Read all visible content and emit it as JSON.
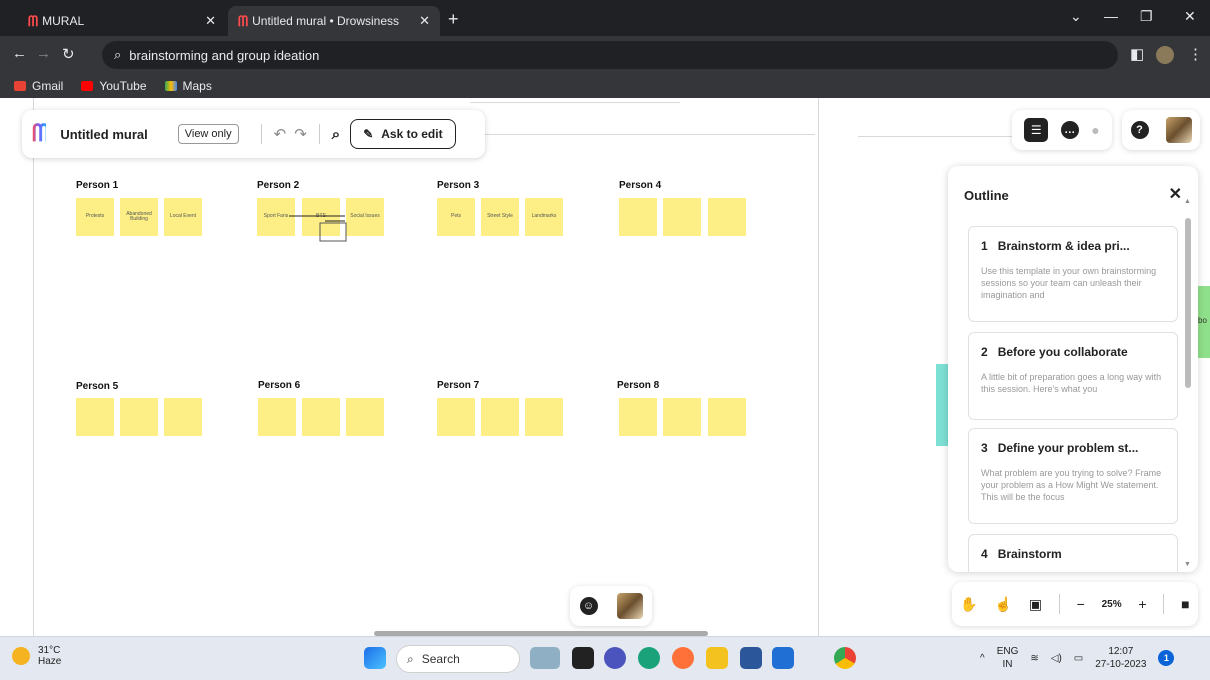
{
  "browser": {
    "tabs": [
      {
        "label": "MURAL"
      },
      {
        "label": "Untitled mural • Drowsiness dete"
      }
    ],
    "address": "brainstorming and group ideation",
    "bookmarks": [
      "Gmail",
      "YouTube",
      "Maps"
    ]
  },
  "toolbar": {
    "title": "Untitled mural",
    "view_only": "View only",
    "ask_to_edit": "Ask to edit"
  },
  "board": {
    "persons": [
      {
        "label": "Person 1",
        "notes": [
          "Protests",
          "Abandoned Building",
          "Local Event"
        ]
      },
      {
        "label": "Person 2",
        "notes": [
          "Sport Fans",
          "BTS",
          "Social Issues"
        ]
      },
      {
        "label": "Person 3",
        "notes": [
          "Pets",
          "Street Style",
          "Landmarks"
        ]
      },
      {
        "label": "Person 4",
        "notes": [
          "",
          "",
          ""
        ]
      },
      {
        "label": "Person 5",
        "notes": [
          "",
          "",
          ""
        ]
      },
      {
        "label": "Person 6",
        "notes": [
          "",
          "",
          ""
        ]
      },
      {
        "label": "Person 7",
        "notes": [
          "",
          "",
          ""
        ]
      },
      {
        "label": "Person 8",
        "notes": [
          "",
          "",
          ""
        ]
      }
    ]
  },
  "outline": {
    "title": "Outline",
    "items": [
      {
        "num": "1",
        "title": "Brainstorm & idea pri...",
        "desc": "Use this template in your own brainstorming sessions so your team can unleash their imagination and"
      },
      {
        "num": "2",
        "title": "Before you collaborate",
        "desc": "A little bit of preparation goes a long way with this session. Here's what you"
      },
      {
        "num": "3",
        "title": "Define your problem st...",
        "desc": "What problem are you trying to solve? Frame your problem as a How Might We statement. This will be the focus"
      },
      {
        "num": "4",
        "title": "Brainstorm",
        "desc": ""
      }
    ]
  },
  "zoom": {
    "level": "25%"
  },
  "edge_label": "bo",
  "taskbar": {
    "temp": "31°C",
    "weather": "Haze",
    "search": "Search",
    "lang": "ENG",
    "region": "IN",
    "time": "12:07",
    "date": "27-10-2023",
    "notifications": "1"
  },
  "colors": {
    "sticky": "#fdef86",
    "accent": "#ff4b4b"
  }
}
